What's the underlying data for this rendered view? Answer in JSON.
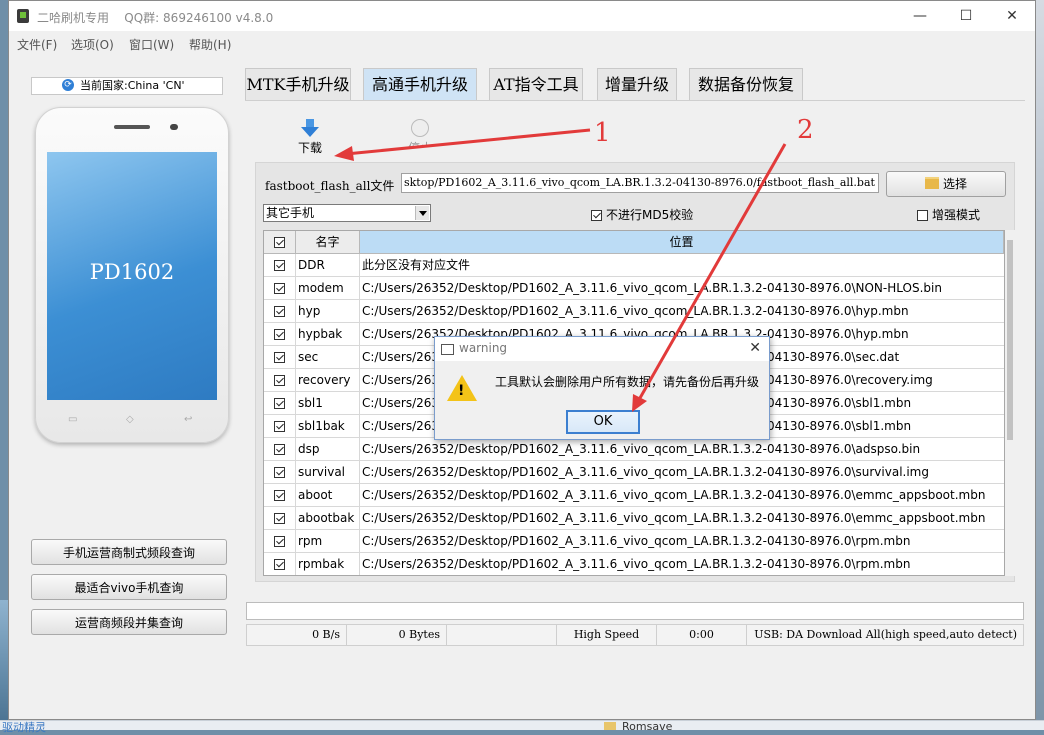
{
  "window": {
    "title": "二哈刷机专用",
    "qq_label": "QQ群:",
    "qq_number": "869246100",
    "version": "v4.8.0",
    "minimize": "—",
    "maximize": "☐",
    "close": "✕"
  },
  "menu": [
    "文件(F)",
    "选项(O)",
    "窗口(W)",
    "帮助(H)"
  ],
  "left": {
    "country": "当前国家:China 'CN'",
    "phone_model": "PD1602",
    "buttons": [
      "手机运营商制式频段查询",
      "最适合vivo手机查询",
      "运营商频段并集查询"
    ]
  },
  "tabs": [
    {
      "label": "MTK手机升级",
      "active": false
    },
    {
      "label": "高通手机升级",
      "active": true
    },
    {
      "label": "AT指令工具",
      "active": false
    },
    {
      "label": "增量升级",
      "active": false
    },
    {
      "label": "数据备份恢复",
      "active": false
    }
  ],
  "toolbar": {
    "download": "下载",
    "stop": "停止"
  },
  "file": {
    "label": "fastboot_flash_all文件",
    "path": "sktop/PD1602_A_3.11.6_vivo_qcom_LA.BR.1.3.2-04130-8976.0/fastboot_flash_all.bat",
    "select_button": "选择"
  },
  "options": {
    "phone_select": "其它手机",
    "skip_md5": "不进行MD5校验",
    "skip_md5_checked": true,
    "enhanced": "增强模式",
    "enhanced_checked": false
  },
  "grid": {
    "header_name": "名字",
    "header_location": "位置",
    "rows": [
      {
        "name": "DDR",
        "path": "此分区没有对应文件",
        "checked": true
      },
      {
        "name": "modem",
        "path": "C:/Users/26352/Desktop/PD1602_A_3.11.6_vivo_qcom_LA.BR.1.3.2-04130-8976.0\\NON-HLOS.bin",
        "checked": true
      },
      {
        "name": "hyp",
        "path": "C:/Users/26352/Desktop/PD1602_A_3.11.6_vivo_qcom_LA.BR.1.3.2-04130-8976.0\\hyp.mbn",
        "checked": true
      },
      {
        "name": "hypbak",
        "path": "C:/Users/26352/Desktop/PD1602_A_3.11.6_vivo_qcom_LA.BR.1.3.2-04130-8976.0\\hyp.mbn",
        "checked": true
      },
      {
        "name": "sec",
        "path": "C:/Users/26352/Desktop/PD1602_A_3.11.6_vivo_qcom_LA.BR.1.3.2-04130-8976.0\\sec.dat",
        "checked": true
      },
      {
        "name": "recovery",
        "path": "C:/Users/26352/Desktop/PD1602_A_3.11.6_vivo_qcom_LA.BR.1.3.2-04130-8976.0\\recovery.img",
        "checked": true
      },
      {
        "name": "sbl1",
        "path": "C:/Users/26352/Desktop/PD1602_A_3.11.6_vivo_qcom_LA.BR.1.3.2-04130-8976.0\\sbl1.mbn",
        "checked": true
      },
      {
        "name": "sbl1bak",
        "path": "C:/Users/26352/Desktop/PD1602_A_3.11.6_vivo_qcom_LA.BR.1.3.2-04130-8976.0\\sbl1.mbn",
        "checked": true
      },
      {
        "name": "dsp",
        "path": "C:/Users/26352/Desktop/PD1602_A_3.11.6_vivo_qcom_LA.BR.1.3.2-04130-8976.0\\adspso.bin",
        "checked": true
      },
      {
        "name": "survival",
        "path": "C:/Users/26352/Desktop/PD1602_A_3.11.6_vivo_qcom_LA.BR.1.3.2-04130-8976.0\\survival.img",
        "checked": true
      },
      {
        "name": "aboot",
        "path": "C:/Users/26352/Desktop/PD1602_A_3.11.6_vivo_qcom_LA.BR.1.3.2-04130-8976.0\\emmc_appsboot.mbn",
        "checked": true
      },
      {
        "name": "abootbak",
        "path": "C:/Users/26352/Desktop/PD1602_A_3.11.6_vivo_qcom_LA.BR.1.3.2-04130-8976.0\\emmc_appsboot.mbn",
        "checked": true
      },
      {
        "name": "rpm",
        "path": "C:/Users/26352/Desktop/PD1602_A_3.11.6_vivo_qcom_LA.BR.1.3.2-04130-8976.0\\rpm.mbn",
        "checked": true
      },
      {
        "name": "rpmbak",
        "path": "C:/Users/26352/Desktop/PD1602_A_3.11.6_vivo_qcom_LA.BR.1.3.2-04130-8976.0\\rpm.mbn",
        "checked": true
      }
    ]
  },
  "status": {
    "speed": "0 B/s",
    "bytes": "0 Bytes",
    "mode": "High Speed",
    "time": "0:00",
    "usb": "USB: DA Download All(high speed,auto detect)"
  },
  "dialog": {
    "title": "warning",
    "message": "工具默认会删除用户所有数据，请先备份后再升级",
    "ok": "OK",
    "close": "✕"
  },
  "annotations": {
    "one": "1",
    "two": "2",
    "color": "#e23a3a"
  },
  "desktop": {
    "folder": "Romsave",
    "corner_text": "驱动精灵"
  }
}
